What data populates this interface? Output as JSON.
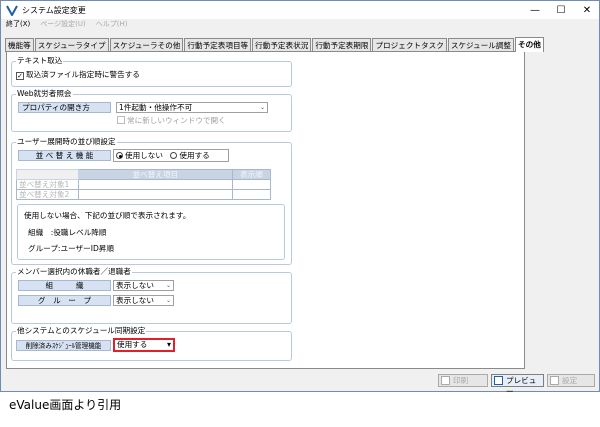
{
  "window": {
    "title": "システム設定変更",
    "menus": [
      {
        "label": "終了(X)",
        "enabled": true
      },
      {
        "label": "ページ設定(U)",
        "enabled": false
      },
      {
        "label": "ヘルプ(H)",
        "enabled": false
      }
    ]
  },
  "tabs": [
    "機能等",
    "スケジューラタイプ",
    "スケジューラその他",
    "行動予定表項目等",
    "行動予定表状況",
    "行動予定表期限",
    "プロジェクトタスク",
    "スケジュール調整",
    "その他"
  ],
  "active_tab": "その他",
  "text_import": {
    "title": "テキスト取込",
    "checkbox_label": "取込済ファイル指定時に警告する",
    "checked": true
  },
  "web_attendance": {
    "title": "Web就労者照会",
    "property_label": "プロパティの開き方",
    "property_value": "1件起動・他操作不可",
    "new_window_label": "常に新しいウィンドウで開く",
    "new_window_checked": false
  },
  "user_sort": {
    "title": "ユーザー展開時の並び順設定",
    "sort_label": "並 べ 替 え 機 能",
    "opt_off": "使用しない",
    "opt_on": "使用する",
    "selected": "使用しない",
    "table": {
      "col_item": "並べ替え項目",
      "col_order": "表示順",
      "rows": [
        "並べ替え対象1",
        "並べ替え対象2"
      ]
    },
    "note": [
      "使用しない場合、下記の並び順で表示されます。",
      "組織　:役職レベル降順",
      "グループ:ユーザーID昇順"
    ]
  },
  "member_selection": {
    "title": "メンバー選択内の休職者／退職者",
    "rows": [
      {
        "label": "組　　　織",
        "value": "表示しない"
      },
      {
        "label": "グ　ル　ー　プ",
        "value": "表示しない"
      }
    ]
  },
  "schedule_sync": {
    "title": "他システムとのスケジュール同期設定",
    "label": "削除済みｽｹｼﾞｭｰﾙ管理機能",
    "value": "使用する",
    "highlight_color": "#e0202a"
  },
  "buttons": {
    "print": "印刷",
    "preview": "プレビュー",
    "settings": "設定"
  },
  "caption": "eValue画面より引用",
  "colors": {
    "label_bg": "#d6e2f1",
    "frame_border": "#6f8db3"
  }
}
